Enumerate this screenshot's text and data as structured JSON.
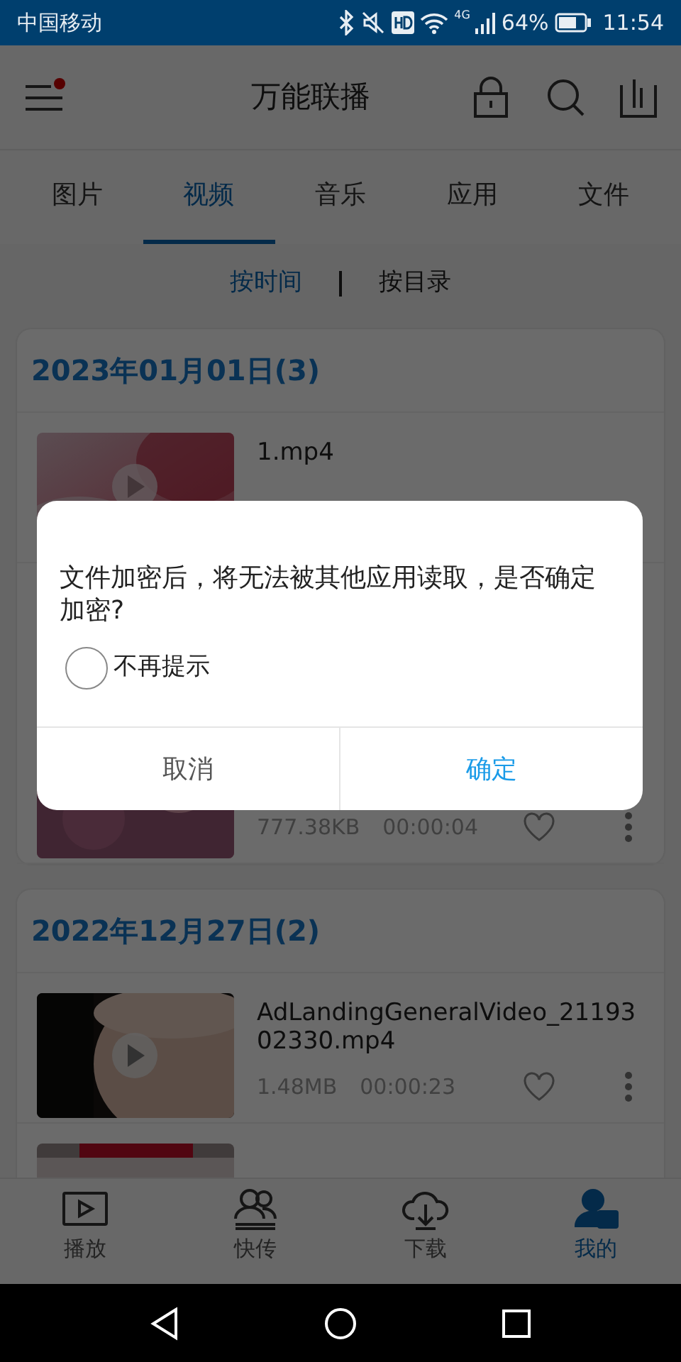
{
  "status_bar": {
    "carrier": "中国移动",
    "network": "4G",
    "battery": "64%",
    "time": "11:54"
  },
  "header": {
    "title": "万能联播",
    "menu_badge": true
  },
  "tabs": [
    {
      "label": "图片",
      "selected": false
    },
    {
      "label": "视频",
      "selected": true
    },
    {
      "label": "音乐",
      "selected": false
    },
    {
      "label": "应用",
      "selected": false
    },
    {
      "label": "文件",
      "selected": false
    }
  ],
  "sort_options": [
    {
      "label": "按时间",
      "selected": true
    },
    {
      "label": "按目录",
      "selected": false
    }
  ],
  "groups": [
    {
      "date": "2023年01月01日(3)",
      "items": [
        {
          "thumbnail": {
            "kind": "picture"
          },
          "name": "1.mp4"
        },
        {
          "thumbnail": {
            "kind": "picture"
          },
          "size": "777.38KB",
          "duration": "00:00:04",
          "favorite": false
        }
      ]
    },
    {
      "date": "2022年12月27日(2)",
      "items": [
        {
          "thumbnail": {
            "kind": "picture"
          },
          "name": "AdLandingGeneralVideo_2119302330.mp4",
          "size": "1.48MB",
          "duration": "00:00:23",
          "favorite": false
        },
        {
          "thumbnail": {
            "kind": "picture"
          }
        }
      ]
    }
  ],
  "bottom_nav": [
    {
      "label": "播放",
      "selected": false
    },
    {
      "label": "快传",
      "selected": false
    },
    {
      "label": "下载",
      "selected": false
    },
    {
      "label": "我的",
      "selected": true
    }
  ],
  "dialog": {
    "message": "文件加密后，将无法被其他应用读取，是否确定加密?",
    "checkbox": {
      "label": "不再提示",
      "checked": false
    },
    "buttons": [
      {
        "label": "取消",
        "kind": "cancel"
      },
      {
        "label": "确定",
        "kind": "confirm"
      }
    ]
  }
}
